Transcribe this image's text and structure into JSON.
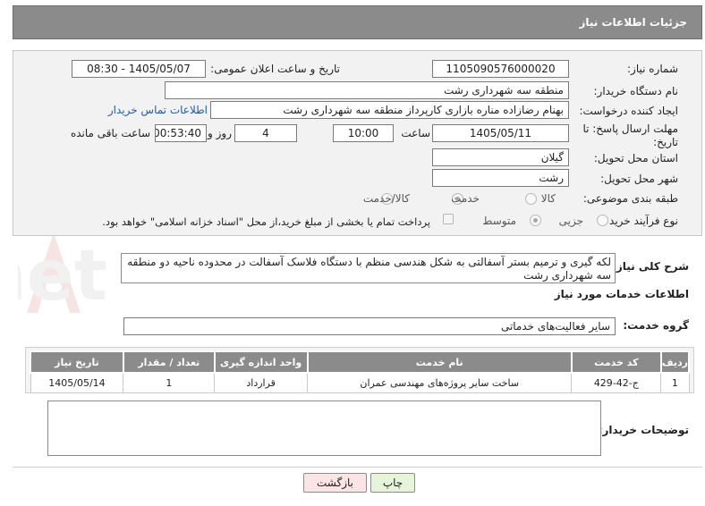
{
  "header": {
    "title": "جزئیات اطلاعات نیاز"
  },
  "form": {
    "need_number_label": "شماره نیاز:",
    "need_number": "1105090576000020",
    "announce_label": "تاریخ و ساعت اعلان عمومی:",
    "announce_value": "1405/05/07 - 08:30",
    "buyer_org_label": "نام دستگاه خریدار:",
    "buyer_org": "منطقه سه شهرداری رشت",
    "creator_label": "ایجاد کننده درخواست:",
    "creator": "بهنام رضازاده مناره بازاری کارپرداز  منطقه سه شهرداری رشت",
    "contact_link": "اطلاعات تماس خریدار",
    "deadline_label_1": "مهلت ارسال پاسخ: تا",
    "deadline_label_2": "تاریخ:",
    "deadline_date": "1405/05/11",
    "time_label": "ساعت",
    "deadline_time": "10:00",
    "days_value": "4",
    "days_label": "روز و",
    "remaining_time": "00:53:40",
    "remaining_label": "ساعت باقی مانده",
    "province_label": "استان محل تحویل:",
    "province": "گیلان",
    "city_label": "شهر محل تحویل:",
    "city": "رشت",
    "category_label": "طبقه بندی موضوعی:",
    "category_options": [
      "کالا",
      "خدمت",
      "کالا/خدمت"
    ],
    "category_selected": "خدمت",
    "process_label": "نوع فرآیند خرید :",
    "process_options": [
      "جزیی",
      "متوسط"
    ],
    "process_selected": "متوسط",
    "payment_note": "پرداخت تمام یا بخشی از مبلغ خرید،از محل \"اسناد خزانه اسلامی\" خواهد بود."
  },
  "description": {
    "label": "شرح کلی نیاز:",
    "text": "لکه گیری و ترمیم بستر آسفالتی به شکل هندسی منظم با دستگاه فلاسک آسفالت در محدوده ناحیه دو منطقه سه شهرداری رشت"
  },
  "services": {
    "section_title": "اطلاعات خدمات مورد نیاز",
    "group_label": "گروه خدمت:",
    "group_value": "سایر فعالیت‌های خدماتی",
    "columns": [
      "ردیف",
      "کد خدمت",
      "نام خدمت",
      "واحد اندازه گیری",
      "تعداد / مقدار",
      "تاریخ نیاز"
    ],
    "rows": [
      [
        "1",
        "ج-42-429",
        "ساخت سایر پروژه‌های مهندسی عمران",
        "قرارداد",
        "1",
        "1405/05/14"
      ]
    ]
  },
  "buyer_notes": {
    "label": "توضیحات خریدار:",
    "text": ""
  },
  "buttons": {
    "print": "چاپ",
    "back": "بازگشت"
  },
  "watermark": {
    "text": "AriaTender.net"
  },
  "colors": {
    "header_bg": "#8b8b8b",
    "link": "#1f5fa8",
    "print_btn": "#e6f5d9",
    "back_btn": "#fbe4e4"
  }
}
